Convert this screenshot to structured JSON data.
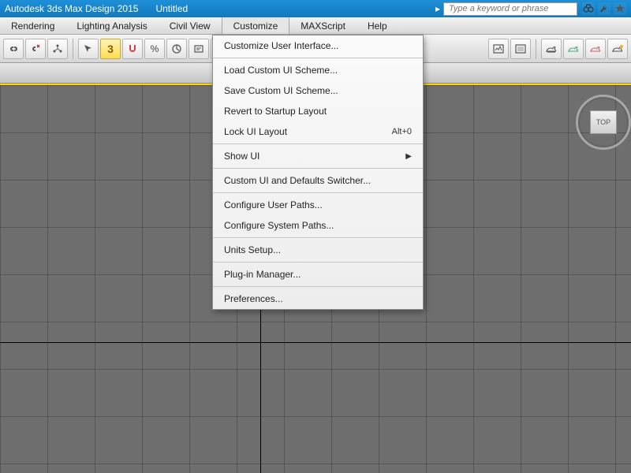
{
  "title": {
    "app": "Autodesk 3ds Max Design 2015",
    "doc": "Untitled"
  },
  "search": {
    "placeholder": "Type a keyword or phrase"
  },
  "menubar": [
    "Rendering",
    "Lighting Analysis",
    "Civil View",
    "Customize",
    "MAXScript",
    "Help"
  ],
  "activeMenuIndex": 3,
  "toolbar": {
    "angle_snap_value": "3",
    "angle_label": "%"
  },
  "dropdown": {
    "items": [
      {
        "label": "Customize User Interface...",
        "type": "item"
      },
      {
        "type": "sep"
      },
      {
        "label": "Load Custom UI Scheme...",
        "type": "item"
      },
      {
        "label": "Save Custom UI Scheme...",
        "type": "item"
      },
      {
        "label": "Revert to Startup Layout",
        "type": "item"
      },
      {
        "label": "Lock UI Layout",
        "type": "item",
        "shortcut": "Alt+0"
      },
      {
        "type": "sep"
      },
      {
        "label": "Show UI",
        "type": "submenu"
      },
      {
        "type": "sep"
      },
      {
        "label": "Custom UI and Defaults Switcher...",
        "type": "item"
      },
      {
        "type": "sep"
      },
      {
        "label": "Configure User Paths...",
        "type": "item"
      },
      {
        "label": "Configure System Paths...",
        "type": "item"
      },
      {
        "type": "sep"
      },
      {
        "label": "Units Setup...",
        "type": "item"
      },
      {
        "type": "sep"
      },
      {
        "label": "Plug-in Manager...",
        "type": "item"
      },
      {
        "type": "sep"
      },
      {
        "label": "Preferences...",
        "type": "item"
      }
    ]
  },
  "viewcube": {
    "face": "TOP"
  }
}
